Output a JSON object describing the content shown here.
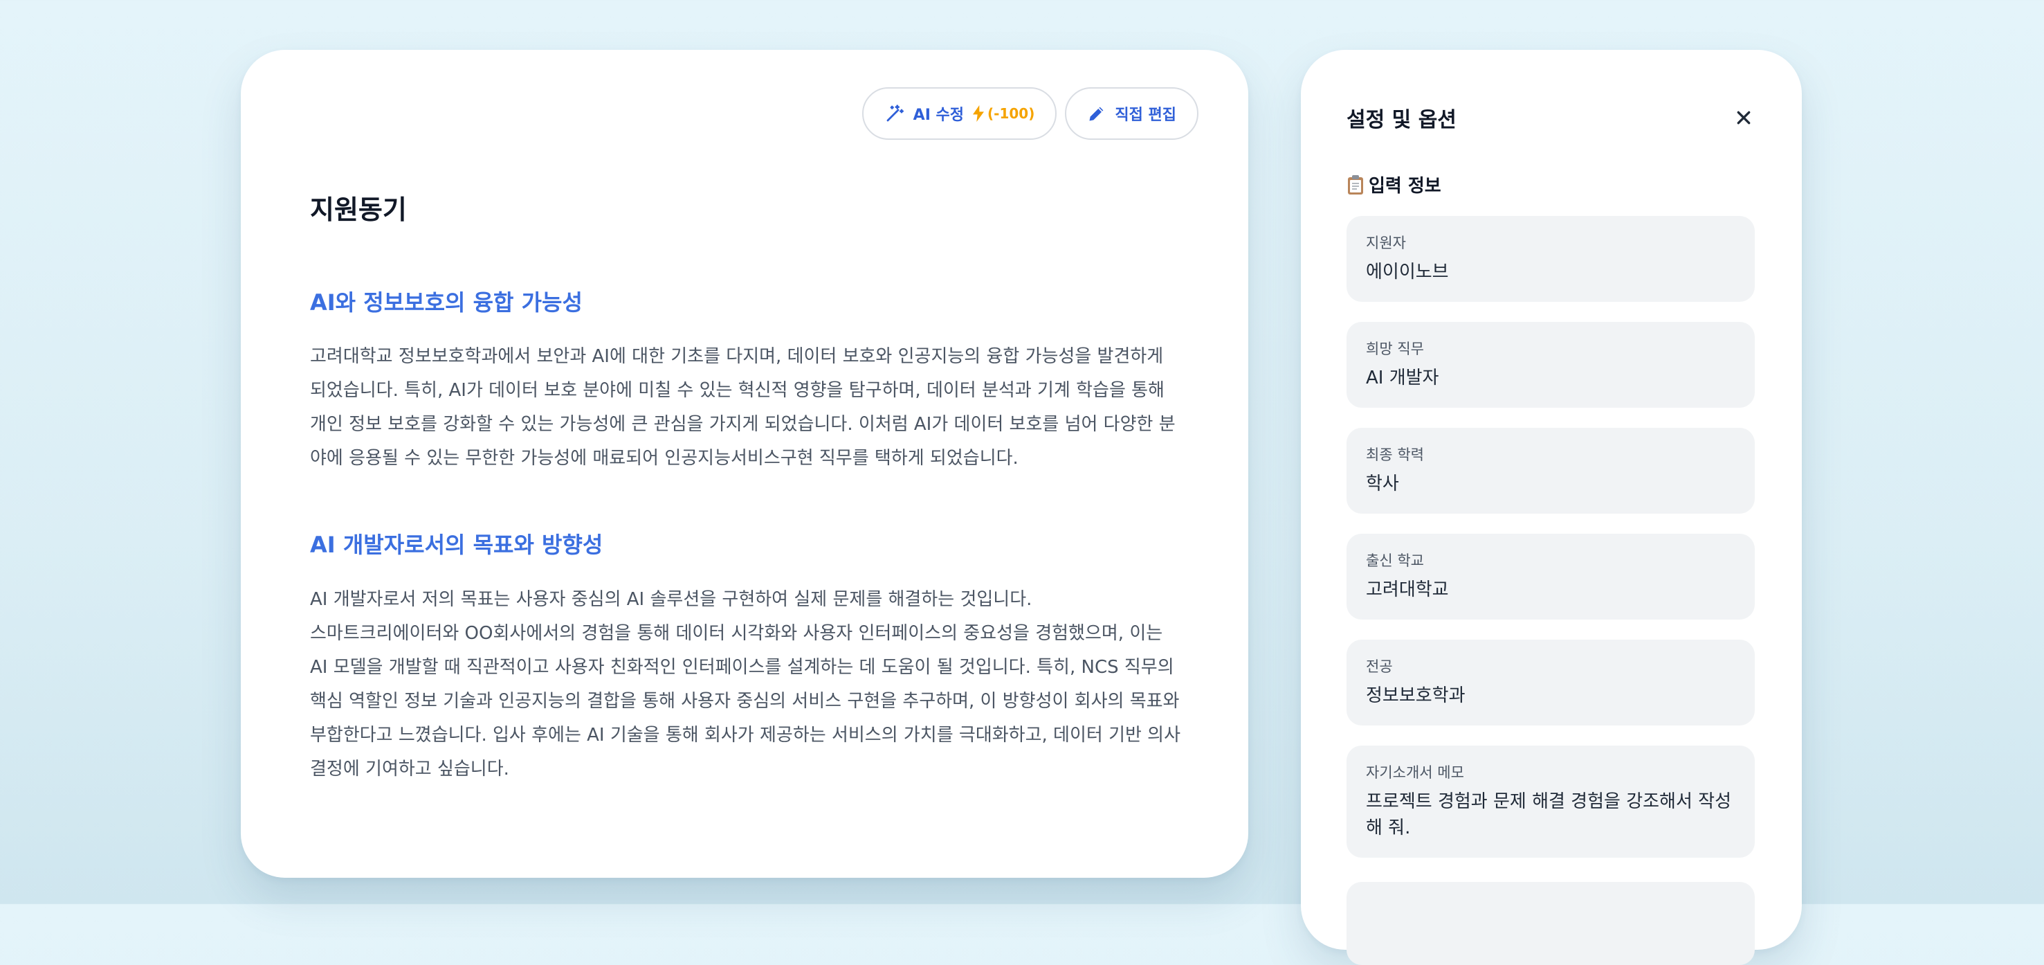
{
  "document": {
    "ai_edit_button": {
      "label": "AI 수정",
      "cost": "(-100)"
    },
    "direct_edit_button": {
      "label": "직접 편집"
    },
    "title": "지원동기",
    "sections": [
      {
        "heading": "AI와 정보보호의 융합 가능성",
        "paragraphs": [
          "고려대학교 정보보호학과에서 보안과 AI에 대한 기초를 다지며, 데이터 보호와 인공지능의 융합 가능성을 발견하게 되었습니다. 특히, AI가 데이터 보호 분야에 미칠 수 있는 혁신적 영향을 탐구하며, 데이터 분석과 기계 학습을 통해 개인 정보 보호를 강화할 수 있는 가능성에 큰 관심을 가지게 되었습니다. 이처럼 AI가 데이터 보호를 넘어 다양한 분야에 응용될 수 있는 무한한 가능성에 매료되어 인공지능서비스구현 직무를 택하게 되었습니다."
        ]
      },
      {
        "heading": "AI 개발자로서의 목표와 방향성",
        "paragraphs": [
          "AI 개발자로서 저의 목표는 사용자 중심의 AI 솔루션을 구현하여 실제 문제를 해결하는 것입니다.",
          "스마트크리에이터와 OO회사에서의 경험을 통해 데이터 시각화와 사용자 인터페이스의 중요성을 경험했으며, 이는 AI 모델을 개발할 때 직관적이고 사용자 친화적인 인터페이스를 설계하는 데 도움이 될 것입니다. 특히, NCS 직무의 핵심 역할인 정보 기술과 인공지능의 결합을 통해 사용자 중심의 서비스 구현을 추구하며, 이 방향성이 회사의 목표와 부합한다고 느꼈습니다. 입사 후에는 AI 기술을 통해 회사가 제공하는 서비스의 가치를 극대화하고, 데이터 기반 의사결정에 기여하고 싶습니다."
        ]
      }
    ]
  },
  "settings": {
    "title": "설정 및 옵션",
    "section_label": "입력 정보",
    "fields": [
      {
        "label": "지원자",
        "value": "에이이노브"
      },
      {
        "label": "희망 직무",
        "value": "AI 개발자"
      },
      {
        "label": "최종 학력",
        "value": "학사"
      },
      {
        "label": "출신 학교",
        "value": "고려대학교"
      },
      {
        "label": "전공",
        "value": "정보보호학과"
      },
      {
        "label": "자기소개서 메모",
        "value": "프로젝트 경험과 문제 해결 경험을 강조해서 작성해 줘."
      }
    ]
  },
  "colors": {
    "accent": "#3b6fe0",
    "cost": "#f5a300",
    "background": "#e4f4fa"
  },
  "icons": {
    "ai_edit": "magic-wand-icon",
    "cost": "lightning-icon",
    "direct_edit": "pencil-icon",
    "close": "close-icon",
    "section": "clipboard-icon"
  }
}
